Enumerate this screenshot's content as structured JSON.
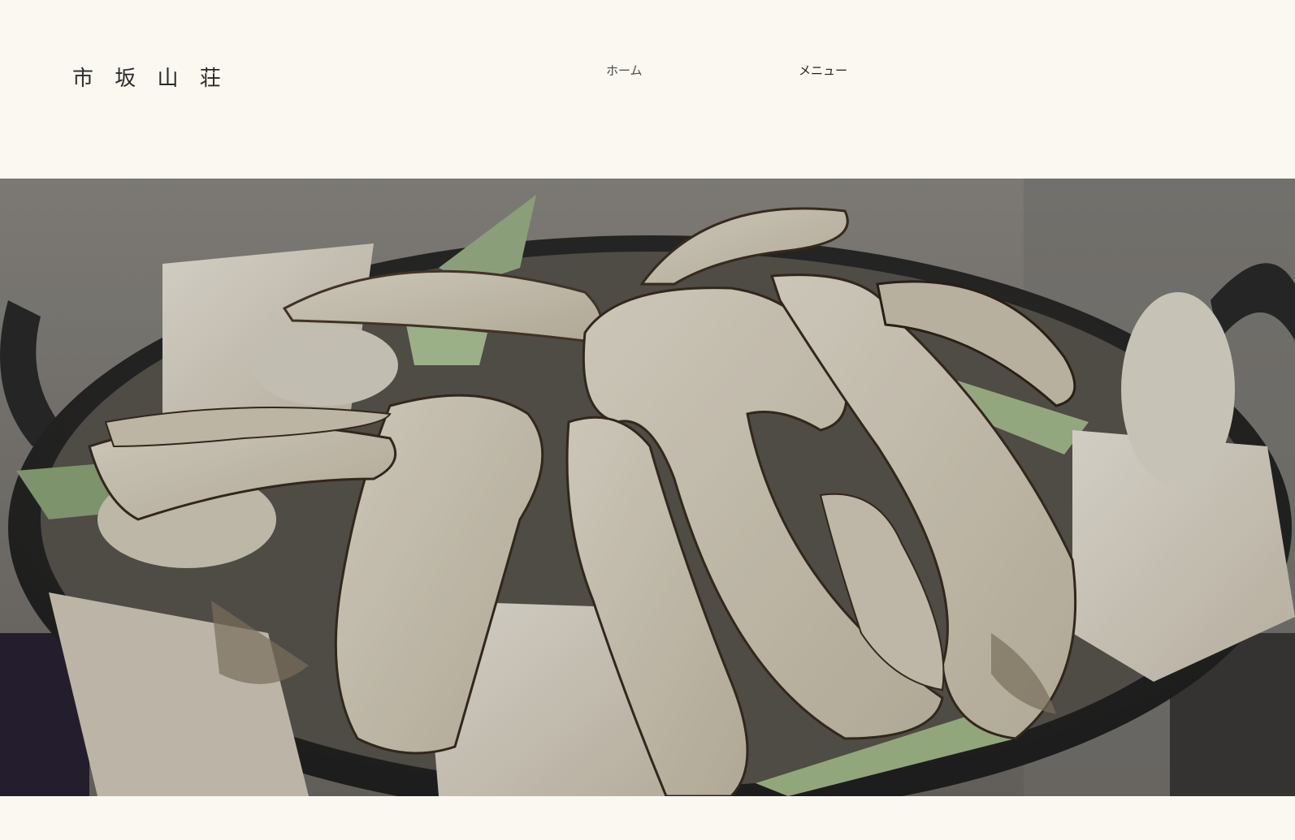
{
  "site": {
    "logo_text": "市 坂 山 荘"
  },
  "nav": {
    "items": [
      {
        "label": "ホーム"
      },
      {
        "label": "メニュー"
      }
    ]
  },
  "hero": {
    "image_subject": "matsutake-hotpot-photo"
  },
  "colors": {
    "background": "#faf8f1",
    "text": "#2a2a2a"
  }
}
